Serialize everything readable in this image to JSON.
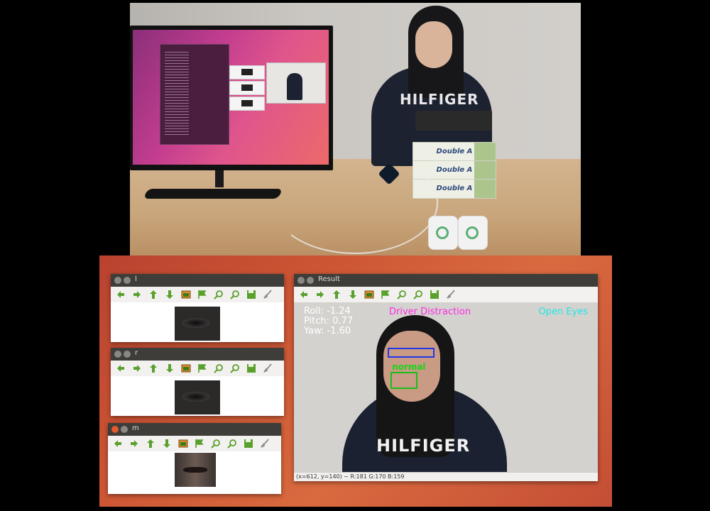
{
  "window_l": {
    "title": "l"
  },
  "window_r": {
    "title": "r"
  },
  "window_m": {
    "title": "m"
  },
  "window_result": {
    "title": "Result",
    "roll": "Roll: -1.24",
    "pitch": "Pitch: 0.77",
    "yaw": "Yaw: -1.60",
    "driver_status": "Driver Distraction",
    "eye_status": "Open Eyes",
    "mouth_status": "normal",
    "statusbar": "(x=612, y=140) ~ R:181 G:170 B:159"
  },
  "photo": {
    "hoodie_text": "HILFIGER",
    "paper_label": "Double A"
  },
  "toolbar_icons": [
    "left-arrow-icon",
    "right-arrow-icon",
    "up-arrow-icon",
    "down-arrow-icon",
    "image-icon",
    "flag-icon",
    "zoom-in-icon",
    "zoom-out-icon",
    "save-icon",
    "brush-icon"
  ],
  "colors": {
    "driver_status": "#ff2ce6",
    "eye_status": "#22e6e6",
    "eye_box": "#2238e8",
    "mouth_box": "#18c018",
    "toolbar_green": "#5aa02c"
  }
}
